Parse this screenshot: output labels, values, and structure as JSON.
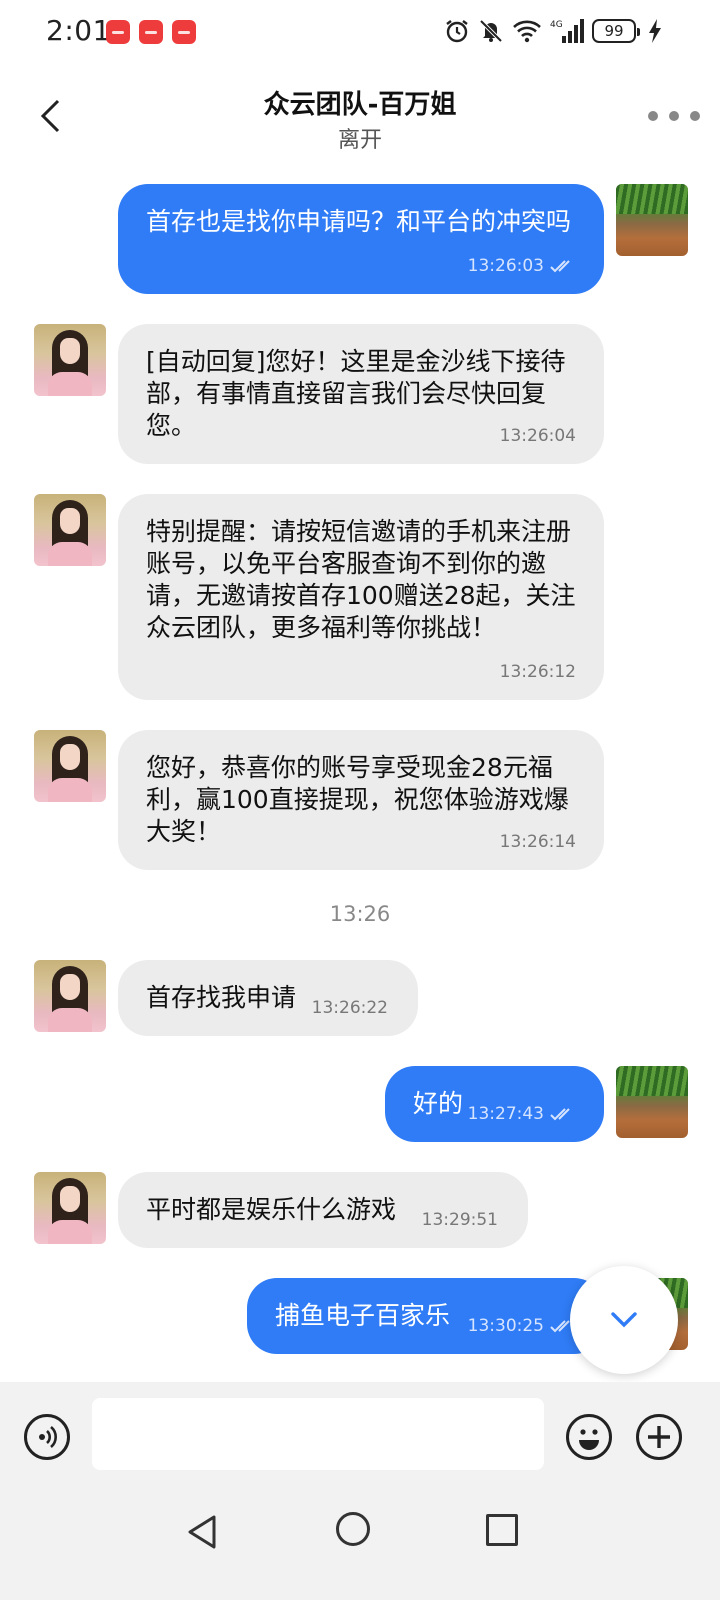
{
  "status_bar": {
    "time": "2:01",
    "signal_label": "4G",
    "battery": "99"
  },
  "header": {
    "title": "众云团队-百万姐",
    "subtitle": "离开"
  },
  "messages": [
    {
      "direction": "out",
      "text": "首存也是找你申请吗？和平台的冲突吗",
      "time": "13:26:03"
    },
    {
      "direction": "in",
      "text": "[自动回复]您好！这里是金沙线下接待部，有事情直接留言我们会尽快回复您。",
      "time": "13:26:04"
    },
    {
      "direction": "in",
      "text": "特别提醒：请按短信邀请的手机来注册账号，以免平台客服查询不到你的邀请，无邀请按首存100赠送28起，关注众云团队，更多福利等你挑战！",
      "time": "13:26:12"
    },
    {
      "direction": "in",
      "text": "您好，恭喜你的账号享受现金28元福利，赢100直接提现，祝您体验游戏爆大奖！",
      "time": "13:26:14"
    },
    {
      "direction": "divider",
      "text": "13:26"
    },
    {
      "direction": "in",
      "text": "首存找我申请",
      "time": "13:26:22"
    },
    {
      "direction": "out",
      "text": "好的",
      "time": "13:27:43"
    },
    {
      "direction": "in",
      "text": "平时都是娱乐什么游戏",
      "time": "13:29:51"
    },
    {
      "direction": "out",
      "text": "捕鱼电子百家乐",
      "time": "13:30:25"
    }
  ],
  "input": {
    "placeholder": ""
  },
  "colors": {
    "outgoing_bubble": "#2f7cf6",
    "incoming_bubble": "#ececec"
  }
}
